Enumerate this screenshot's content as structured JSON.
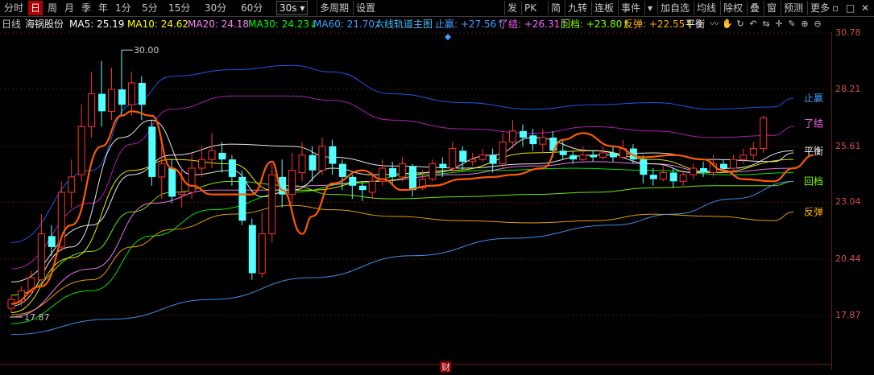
{
  "toolbar": {
    "left_items": [
      "分时",
      "日",
      "周",
      "月",
      "季",
      "年",
      "1分",
      "5分",
      "15分",
      "30分",
      "60分"
    ],
    "active_item": "日",
    "period_select": "30s",
    "extra_items": [
      "多周期",
      "设置"
    ],
    "right_items": [
      "发",
      "PK",
      "简",
      "九转",
      "连板",
      "事件"
    ],
    "right_items2": [
      "加自选",
      "均线",
      "除权",
      "叠",
      "窗",
      "预测",
      "更多"
    ]
  },
  "info": {
    "period": "日线",
    "stock_name": "海锅股份",
    "ma5": "MA5: 25.19",
    "ma10": "MA10: 24.62",
    "ma20": "MA20: 24.18",
    "ma30": "MA30: 24.23↓",
    "ma60": "MA60: 21.70↓",
    "indicator": "六线轨道主图",
    "zhiying": "止赢: +27.56↑",
    "liaojie": "了结: +26.31↑",
    "huidang": "回档: +23.80↑",
    "fantan": "反弹: +22.55↑",
    "pingheng": "平衡"
  },
  "colors": {
    "up": "#ff3232",
    "down": "#54ffff",
    "ma5": "#ffffff",
    "ma10": "#ffff00",
    "ma20": "#ff80ff",
    "ma30": "#00ff00",
    "ma60": "#40a0ff",
    "zhiying": "#2060ff",
    "liaojie": "#c020c0",
    "huidang": "#80ff00",
    "fantan": "#ffb000",
    "pingheng": "#ffffff",
    "trend": "#ff5a00"
  },
  "chart_data": {
    "type": "candlestick",
    "y_ticks": [
      "30.78",
      "28.21",
      "25.61",
      "23.04",
      "20.44",
      "17.87"
    ],
    "ylim": [
      17.87,
      30.78
    ],
    "high_annotation": "30.00",
    "low_annotation": "17.87",
    "line_labels": [
      "止赢",
      "了结",
      "平衡",
      "回档",
      "反弹"
    ],
    "marker_label": "财",
    "candles": [
      [
        18.2,
        18.6,
        18.0,
        18.8
      ],
      [
        18.5,
        19.0,
        18.3,
        19.2
      ],
      [
        19.0,
        19.6,
        18.8,
        19.9
      ],
      [
        19.5,
        21.6,
        19.4,
        22.5
      ],
      [
        21.5,
        21.0,
        20.6,
        22.0
      ],
      [
        21.0,
        23.5,
        20.8,
        24.0
      ],
      [
        23.5,
        24.2,
        22.8,
        25.0
      ],
      [
        24.3,
        26.5,
        24.0,
        27.5
      ],
      [
        26.5,
        28.0,
        26.0,
        29.0
      ],
      [
        28.0,
        27.2,
        26.5,
        29.5
      ],
      [
        27.2,
        28.2,
        26.8,
        29.2
      ],
      [
        28.2,
        27.5,
        27.0,
        30.0
      ],
      [
        27.5,
        28.5,
        27.0,
        29.0
      ],
      [
        28.5,
        27.5,
        26.8,
        28.8
      ],
      [
        26.5,
        24.2,
        23.8,
        26.8
      ],
      [
        24.2,
        24.8,
        23.2,
        25.6
      ],
      [
        24.6,
        23.3,
        23.0,
        25.0
      ],
      [
        23.4,
        23.5,
        22.8,
        24.6
      ],
      [
        23.5,
        24.6,
        23.2,
        25.3
      ],
      [
        24.6,
        25.0,
        24.2,
        25.6
      ],
      [
        25.0,
        25.4,
        24.6,
        26.2
      ],
      [
        25.3,
        25.0,
        24.4,
        25.8
      ],
      [
        25.0,
        24.2,
        23.8,
        25.2
      ],
      [
        24.2,
        22.2,
        22.0,
        24.5
      ],
      [
        22.0,
        19.8,
        19.5,
        22.3
      ],
      [
        19.8,
        21.6,
        19.6,
        22.6
      ],
      [
        21.6,
        24.3,
        21.2,
        24.8
      ],
      [
        24.2,
        23.4,
        22.8,
        25.0
      ],
      [
        23.4,
        24.5,
        23.0,
        25.3
      ],
      [
        24.4,
        25.2,
        24.0,
        25.8
      ],
      [
        25.2,
        24.5,
        24.0,
        25.6
      ],
      [
        24.5,
        25.6,
        24.3,
        26.0
      ],
      [
        25.6,
        24.8,
        24.3,
        25.9
      ],
      [
        24.8,
        24.2,
        23.6,
        25.0
      ],
      [
        24.2,
        23.8,
        23.2,
        24.3
      ],
      [
        23.8,
        23.6,
        23.1,
        24.0
      ],
      [
        23.5,
        24.0,
        23.2,
        24.4
      ],
      [
        24.0,
        24.6,
        23.8,
        25.0
      ],
      [
        24.6,
        24.2,
        23.9,
        24.9
      ],
      [
        24.2,
        24.8,
        24.0,
        25.1
      ],
      [
        24.7,
        23.6,
        23.3,
        24.8
      ],
      [
        23.7,
        24.1,
        23.6,
        24.5
      ],
      [
        24.1,
        24.8,
        24.0,
        25.0
      ],
      [
        24.8,
        24.6,
        24.2,
        25.1
      ],
      [
        24.6,
        25.5,
        24.4,
        25.8
      ],
      [
        25.4,
        24.9,
        24.5,
        25.6
      ],
      [
        24.9,
        25.0,
        24.7,
        25.3
      ],
      [
        25.0,
        25.2,
        24.9,
        25.5
      ],
      [
        25.2,
        24.8,
        24.4,
        25.5
      ],
      [
        24.8,
        25.8,
        24.6,
        26.2
      ],
      [
        25.8,
        26.3,
        25.5,
        26.8
      ],
      [
        26.3,
        26.0,
        25.6,
        26.6
      ],
      [
        26.1,
        25.7,
        25.4,
        26.4
      ],
      [
        25.7,
        26.0,
        25.3,
        26.4
      ],
      [
        26.0,
        25.4,
        25.1,
        26.3
      ],
      [
        25.4,
        25.2,
        25.0,
        25.9
      ],
      [
        25.2,
        25.0,
        24.8,
        25.4
      ],
      [
        25.0,
        25.2,
        24.9,
        25.6
      ],
      [
        25.2,
        25.1,
        24.9,
        25.4
      ],
      [
        25.1,
        25.3,
        25.0,
        25.6
      ],
      [
        25.3,
        25.1,
        24.9,
        25.6
      ],
      [
        25.1,
        25.5,
        25.0,
        25.9
      ],
      [
        25.5,
        25.0,
        24.8,
        25.7
      ],
      [
        25.0,
        24.3,
        23.9,
        25.2
      ],
      [
        24.3,
        24.1,
        23.8,
        24.6
      ],
      [
        24.1,
        24.4,
        24.0,
        24.7
      ],
      [
        24.4,
        24.0,
        23.7,
        24.6
      ],
      [
        24.0,
        24.3,
        23.8,
        24.5
      ],
      [
        24.3,
        24.6,
        24.1,
        24.8
      ],
      [
        24.6,
        24.4,
        24.2,
        24.9
      ],
      [
        24.4,
        24.8,
        24.2,
        25.2
      ],
      [
        24.8,
        24.6,
        24.4,
        25.0
      ],
      [
        24.6,
        25.0,
        24.4,
        25.2
      ],
      [
        25.0,
        25.2,
        24.8,
        25.5
      ],
      [
        25.2,
        25.5,
        25.0,
        25.8
      ],
      [
        25.5,
        26.9,
        25.3,
        27.0
      ]
    ],
    "series": [
      {
        "name": "止赢",
        "points": [
          [
            0,
            21.2
          ],
          [
            8,
            24.5
          ],
          [
            12,
            27.5
          ],
          [
            16,
            28.8
          ],
          [
            22,
            29.1
          ],
          [
            28,
            29.3
          ],
          [
            32,
            29.0
          ],
          [
            38,
            28.0
          ],
          [
            45,
            27.6
          ],
          [
            52,
            27.3
          ],
          [
            58,
            27.5
          ],
          [
            64,
            27.6
          ],
          [
            70,
            27.3
          ],
          [
            76,
            27.4
          ],
          [
            78,
            27.8
          ]
        ]
      },
      {
        "name": "了结",
        "points": [
          [
            0,
            20.0
          ],
          [
            8,
            23.0
          ],
          [
            12,
            25.7
          ],
          [
            16,
            27.3
          ],
          [
            22,
            27.9
          ],
          [
            28,
            27.9
          ],
          [
            32,
            27.7
          ],
          [
            38,
            26.8
          ],
          [
            45,
            26.4
          ],
          [
            52,
            26.2
          ],
          [
            58,
            26.5
          ],
          [
            64,
            26.3
          ],
          [
            70,
            26.0
          ],
          [
            76,
            26.1
          ],
          [
            78,
            26.5
          ]
        ]
      },
      {
        "name": "平衡",
        "points": [
          [
            0,
            19.4
          ],
          [
            8,
            22.0
          ],
          [
            12,
            24.3
          ],
          [
            16,
            25.2
          ],
          [
            22,
            25.7
          ],
          [
            28,
            25.6
          ],
          [
            32,
            25.1
          ],
          [
            38,
            24.7
          ],
          [
            45,
            24.6
          ],
          [
            52,
            24.8
          ],
          [
            58,
            25.2
          ],
          [
            64,
            25.3
          ],
          [
            70,
            25.0
          ],
          [
            76,
            24.9
          ],
          [
            78,
            25.3
          ]
        ]
      },
      {
        "name": "回档",
        "points": [
          [
            0,
            18.8
          ],
          [
            8,
            20.8
          ],
          [
            12,
            22.6
          ],
          [
            16,
            23.5
          ],
          [
            22,
            24.0
          ],
          [
            28,
            23.8
          ],
          [
            32,
            23.4
          ],
          [
            38,
            23.2
          ],
          [
            45,
            23.3
          ],
          [
            52,
            23.4
          ],
          [
            58,
            23.5
          ],
          [
            64,
            23.7
          ],
          [
            70,
            23.8
          ],
          [
            76,
            23.8
          ],
          [
            78,
            24.0
          ]
        ]
      },
      {
        "name": "反弹",
        "points": [
          [
            0,
            17.9
          ],
          [
            8,
            19.5
          ],
          [
            12,
            21.0
          ],
          [
            16,
            21.8
          ],
          [
            22,
            22.5
          ],
          [
            28,
            22.9
          ],
          [
            32,
            22.7
          ],
          [
            38,
            22.4
          ],
          [
            45,
            22.2
          ],
          [
            52,
            22.1
          ],
          [
            58,
            22.2
          ],
          [
            64,
            22.5
          ],
          [
            70,
            22.4
          ],
          [
            76,
            22.2
          ],
          [
            78,
            22.6
          ]
        ]
      },
      {
        "name": "MA60",
        "points": [
          [
            0,
            17.0
          ],
          [
            10,
            17.7
          ],
          [
            20,
            18.6
          ],
          [
            30,
            19.6
          ],
          [
            40,
            20.6
          ],
          [
            50,
            21.4
          ],
          [
            60,
            22.0
          ],
          [
            66,
            22.5
          ],
          [
            72,
            23.2
          ],
          [
            78,
            24.0
          ]
        ]
      },
      {
        "name": "MA30",
        "points": [
          [
            0,
            17.5
          ],
          [
            8,
            19.0
          ],
          [
            14,
            21.5
          ],
          [
            20,
            22.7
          ],
          [
            28,
            23.5
          ],
          [
            34,
            23.9
          ],
          [
            40,
            24.3
          ],
          [
            48,
            24.5
          ],
          [
            56,
            24.6
          ],
          [
            64,
            24.5
          ],
          [
            72,
            24.3
          ],
          [
            78,
            24.4
          ]
        ]
      },
      {
        "name": "MA20",
        "points": [
          [
            0,
            17.8
          ],
          [
            8,
            20.0
          ],
          [
            14,
            23.0
          ],
          [
            20,
            23.6
          ],
          [
            26,
            23.6
          ],
          [
            30,
            23.8
          ],
          [
            36,
            24.0
          ],
          [
            44,
            24.3
          ],
          [
            52,
            24.7
          ],
          [
            58,
            24.9
          ],
          [
            64,
            24.8
          ],
          [
            70,
            24.4
          ],
          [
            78,
            24.6
          ]
        ]
      },
      {
        "name": "MA10",
        "points": [
          [
            0,
            18.0
          ],
          [
            6,
            20.5
          ],
          [
            12,
            24.5
          ],
          [
            16,
            25.0
          ],
          [
            22,
            24.8
          ],
          [
            26,
            23.6
          ],
          [
            30,
            23.6
          ],
          [
            36,
            24.0
          ],
          [
            44,
            24.5
          ],
          [
            52,
            25.3
          ],
          [
            58,
            25.4
          ],
          [
            64,
            25.0
          ],
          [
            70,
            24.4
          ],
          [
            78,
            25.0
          ]
        ]
      },
      {
        "name": "MA5",
        "points": [
          [
            0,
            18.3
          ],
          [
            6,
            21.0
          ],
          [
            11,
            26.0
          ],
          [
            14,
            26.8
          ],
          [
            18,
            24.3
          ],
          [
            22,
            24.5
          ],
          [
            25,
            23.3
          ],
          [
            28,
            23.6
          ],
          [
            32,
            24.6
          ],
          [
            36,
            24.3
          ],
          [
            42,
            24.4
          ],
          [
            48,
            25.2
          ],
          [
            52,
            26.0
          ],
          [
            58,
            25.4
          ],
          [
            64,
            24.8
          ],
          [
            68,
            24.4
          ],
          [
            72,
            24.6
          ],
          [
            78,
            25.4
          ]
        ]
      },
      {
        "name": "趋势",
        "points": [
          [
            0,
            18.4
          ],
          [
            3,
            19.2
          ],
          [
            6,
            22.0
          ],
          [
            9,
            25.6
          ],
          [
            11,
            27.0
          ],
          [
            12,
            27.2
          ],
          [
            14,
            27.0
          ],
          [
            16,
            24.6
          ],
          [
            18,
            23.8
          ],
          [
            20,
            23.4
          ],
          [
            24,
            23.4
          ],
          [
            26,
            24.9
          ],
          [
            27,
            23.6
          ],
          [
            29,
            21.6
          ],
          [
            30,
            22.4
          ],
          [
            32,
            23.9
          ],
          [
            35,
            24.5
          ],
          [
            37,
            24.1
          ],
          [
            39,
            23.6
          ],
          [
            42,
            23.8
          ],
          [
            45,
            24.1
          ],
          [
            48,
            24.2
          ],
          [
            50,
            24.3
          ],
          [
            53,
            24.6
          ],
          [
            55,
            25.9
          ],
          [
            57,
            26.2
          ],
          [
            60,
            25.6
          ],
          [
            63,
            25.1
          ],
          [
            66,
            25.2
          ],
          [
            69,
            25.0
          ],
          [
            71,
            24.5
          ],
          [
            73,
            24.1
          ],
          [
            76,
            24.0
          ],
          [
            78,
            24.6
          ],
          [
            80,
            25.2
          ]
        ]
      }
    ]
  }
}
